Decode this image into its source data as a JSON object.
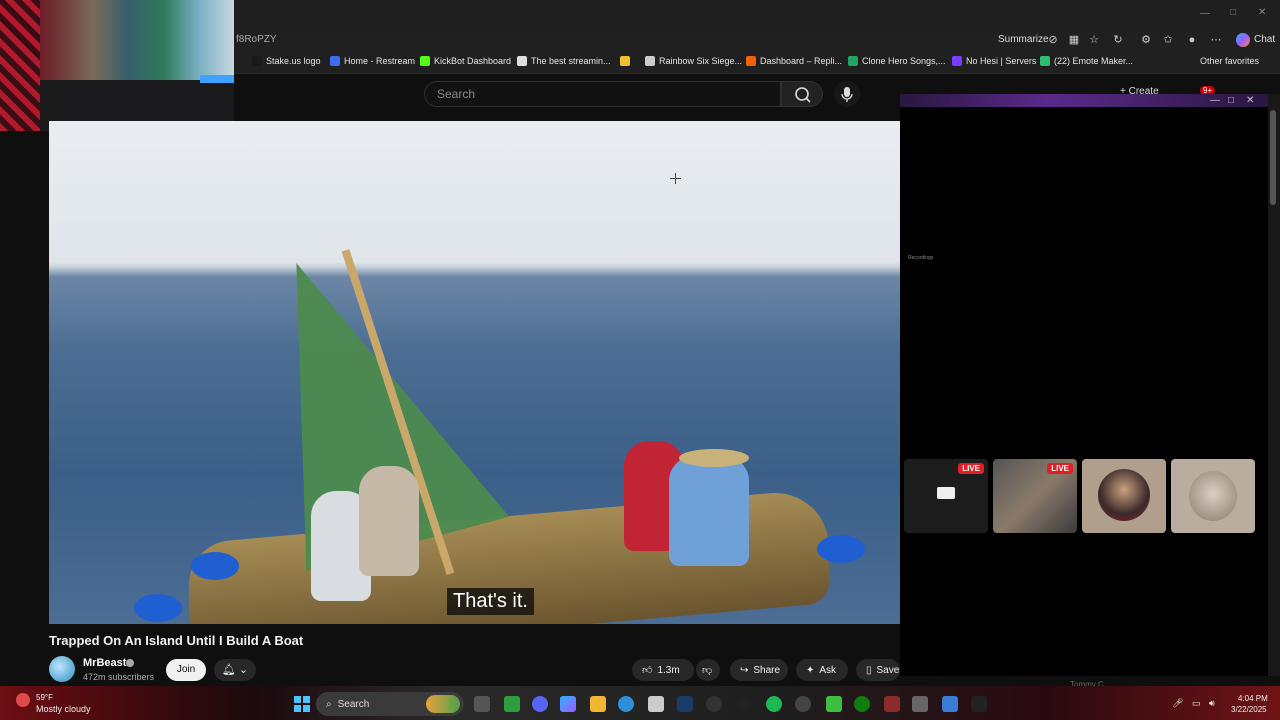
{
  "browser": {
    "url_fragment": "f8RoPZY",
    "summarize_label": "Summarize",
    "chat_label": "Chat",
    "other_favorites": "Other favorites",
    "bookmarks": [
      {
        "label": "Stake.us logo",
        "icon": "s-icon",
        "color": "#1a1a1a"
      },
      {
        "label": "Home - Restream",
        "icon": "restream-icon",
        "color": "#3a6df0"
      },
      {
        "label": "KickBot Dashboard",
        "icon": "kickbot-icon",
        "color": "#53fc18"
      },
      {
        "label": "The best streamin...",
        "icon": "diamond-icon",
        "color": "#dddddd"
      },
      {
        "label": "",
        "icon": "yellow-app-icon",
        "color": "#f2c12e"
      },
      {
        "label": "Rainbow Six Siege...",
        "icon": "six-icon",
        "color": "#cccccc"
      },
      {
        "label": "Dashboard – Repli...",
        "icon": "replit-icon",
        "color": "#f26207"
      },
      {
        "label": "Clone Hero Songs,...",
        "icon": "sheets-icon",
        "color": "#1fa463"
      },
      {
        "label": "No Hesi | Servers",
        "icon": "nohesi-icon",
        "color": "#7a3cff"
      },
      {
        "label": "(22) Emote Maker...",
        "icon": "emote-icon",
        "color": "#2dbf6e"
      }
    ]
  },
  "youtube": {
    "search_placeholder": "Search",
    "create_label": "+ Create",
    "notification_count": "9+",
    "caption": "That's it.",
    "video_title": "Trapped On An Island Until I Build A Boat",
    "channel_name": "MrBeast",
    "subscribers": "472m subscribers",
    "join_label": "Join",
    "like_count": "1.3m",
    "share_label": "Share",
    "ask_label": "Ask",
    "save_label": "Save"
  },
  "popup": {
    "small_label": "Recordings",
    "live_badge": "LIVE",
    "thumbs": [
      {
        "name": "thumb-screen",
        "live": true
      },
      {
        "name": "thumb-stream-gamer",
        "live": true
      },
      {
        "name": "thumb-basketball-player",
        "live": false
      },
      {
        "name": "thumb-monkey",
        "live": false
      }
    ],
    "footer_name": "Tommy C"
  },
  "taskbar": {
    "weather_temp": "59°F",
    "weather_desc": "Mostly cloudy",
    "search_label": "Search",
    "time": "4:04 PM",
    "date": "3/22/2025",
    "accent": "#4cc2ff"
  }
}
